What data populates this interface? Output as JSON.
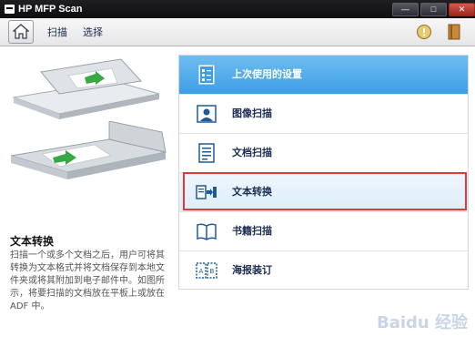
{
  "window": {
    "title": "HP MFP Scan",
    "controls": {
      "minimize": "—",
      "maximize": "□",
      "close": "✕"
    }
  },
  "toolbar": {
    "nav_scan": "扫描",
    "nav_select": "选择",
    "help_icon": "help-icon",
    "book_icon": "book-icon"
  },
  "left_panel": {
    "title": "文本转换",
    "description": "扫描一个或多个文档之后，用户可将其转换为文本格式并将文档保存到本地文件夹或将其附加到电子邮件中。如图所示，将要扫描的文档放在平板上或放在ADF 中。"
  },
  "menu": {
    "items": [
      {
        "label": "上次使用的设置",
        "icon": "checklist-icon",
        "state": "selected"
      },
      {
        "label": "图像扫描",
        "icon": "image-scan-icon",
        "state": "normal"
      },
      {
        "label": "文档扫描",
        "icon": "document-scan-icon",
        "state": "normal"
      },
      {
        "label": "文本转换",
        "icon": "text-convert-icon",
        "state": "highlighted"
      },
      {
        "label": "书籍扫描",
        "icon": "book-scan-icon",
        "state": "normal"
      },
      {
        "label": "海报装订",
        "icon": "poster-icon",
        "state": "normal"
      }
    ]
  },
  "watermark": "Baidu 经验",
  "colors": {
    "selected_gradient_top": "#6fbdf0",
    "selected_gradient_bottom": "#3d9ee5",
    "highlight_border": "#e23a3a",
    "title_bar": "#1f1f22",
    "label_text": "#1d2d52"
  }
}
